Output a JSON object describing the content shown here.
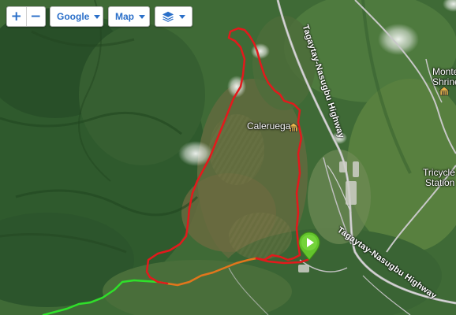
{
  "controls": {
    "zoom_in": "+",
    "zoom_out": "−",
    "map_source": "Google",
    "map_type": "Map"
  },
  "labels": {
    "caleruega": "Caleruega",
    "monte_line1": "Monte",
    "monte_line2": "Shrine",
    "tricycle_line1": "Tricycle",
    "tricycle_line2": "Station",
    "highway_north": "Tagaytay-Nasugbu Highway",
    "highway_south": "Tagaytay-Nasugbu Highway"
  },
  "colors": {
    "route_red": "#e3191c",
    "route_orange": "#e2761c",
    "route_green": "#2fe02a",
    "start_marker": "#63c32c",
    "control_text": "#2a6fc9"
  },
  "icons": [
    "plus-icon",
    "minus-icon",
    "chevron-down-icon",
    "layers-icon",
    "landmark-icon",
    "play-icon"
  ]
}
